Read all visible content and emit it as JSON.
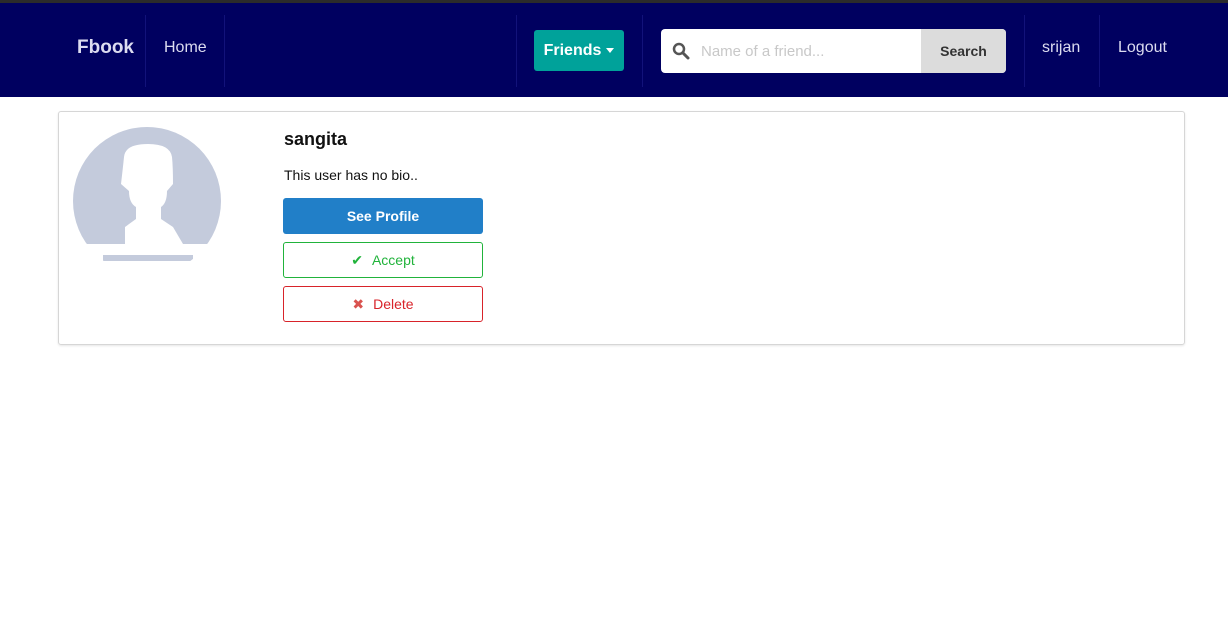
{
  "nav": {
    "brand": "Fbook",
    "home": "Home",
    "friends": "Friends",
    "search_placeholder": "Name of a friend...",
    "search_button": "Search",
    "user": "srijan",
    "logout": "Logout"
  },
  "card": {
    "name": "sangita",
    "bio": "This user has no bio..",
    "see_profile": "See Profile",
    "accept": "Accept",
    "delete": "Delete"
  },
  "colors": {
    "nav": "#000060",
    "friends": "#00a29a",
    "primary": "#217fc8",
    "success": "#21b33b",
    "danger": "#d8232a"
  }
}
